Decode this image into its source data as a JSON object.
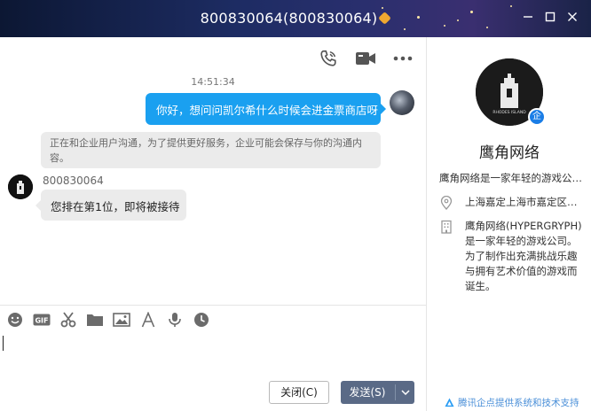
{
  "window": {
    "title": "800830064(800830064)",
    "badge_icon": "crown-badge-icon",
    "controls": [
      "minimize-icon",
      "maximize-icon",
      "close-icon"
    ]
  },
  "chat": {
    "tools": [
      "phone-call-icon",
      "video-call-icon",
      "more-icon"
    ],
    "timestamp": "14:51:34",
    "messages": {
      "outgoing_text": "你好，想问问凯尔希什么时候会进金票商店呀",
      "notice_text": "正在和企业用户沟通，为了提供更好服务，企业可能会保存与你的沟通内容。",
      "agent_name": "800830064",
      "incoming_text": "您排在第1位，即将被接待"
    },
    "input_tools": [
      "emoji-icon",
      "gif-icon",
      "scissors-icon",
      "folder-icon",
      "image-icon",
      "font-icon",
      "voice-icon",
      "clock-icon"
    ],
    "gif_label": "GIF",
    "close_label": "关闭(C)",
    "send_label": "发送(S)"
  },
  "profile": {
    "name": "鹰角网络",
    "badge_text": "企",
    "logo_text": "RHODES ISLAND",
    "desc_short": "鹰角网络是一家年轻的游戏公…",
    "address": "上海嘉定上海市嘉定区…",
    "intro_lines": [
      "鹰角网络(HYPERGRYPH)",
      "是一家年轻的游戏公司。",
      "为了制作出充满挑战乐趣",
      "与拥有艺术价值的游戏而",
      "诞生。"
    ],
    "footer": "腾讯企点提供系统和技术支持"
  },
  "colors": {
    "accent": "#1aa0f0",
    "send_button": "#5a6a86",
    "bubble_in": "#ebebeb",
    "link": "#4a8fd8"
  }
}
